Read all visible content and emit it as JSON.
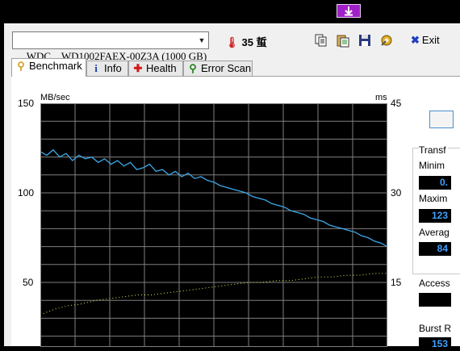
{
  "drive": {
    "name": "WDC    WD1002FAEX-00Z3A (1000 GB)"
  },
  "temperature": {
    "value": "35",
    "unit": "蜇"
  },
  "toolbar": {
    "exit_label": "Exit"
  },
  "tabs": [
    {
      "label": "Benchmark",
      "icon": "benchmark-icon"
    },
    {
      "label": "Info",
      "icon": "info-icon"
    },
    {
      "label": "Health",
      "icon": "health-cross-icon"
    },
    {
      "label": "Error Scan",
      "icon": "magnifier-icon"
    }
  ],
  "chart_data": {
    "type": "line",
    "ylabel": "MB/sec",
    "y2label": "ms",
    "ylim": [
      0,
      150
    ],
    "y2lim": [
      0,
      45
    ],
    "yticks": [
      "150",
      "100",
      "50"
    ],
    "y2ticks": [
      "45",
      "30",
      "15"
    ],
    "grid": true,
    "series": [
      {
        "color": "#3da8e8",
        "values": [
          123,
          121,
          124,
          120,
          122,
          118,
          121,
          119,
          120,
          117,
          119,
          116,
          118,
          115,
          117,
          113,
          114,
          116,
          112,
          113,
          110,
          112,
          109,
          111,
          108,
          109,
          107,
          106,
          104,
          103,
          102,
          101,
          100,
          98,
          97,
          96,
          94,
          93,
          92,
          90,
          89,
          88,
          86,
          85,
          84,
          82,
          81,
          80,
          79,
          78,
          76,
          75,
          73,
          72,
          70
        ]
      },
      {
        "color": "#e8e850",
        "values": [
          32,
          35,
          37,
          38,
          40,
          41,
          42,
          43,
          43,
          44,
          45,
          46,
          47,
          48,
          49,
          50,
          50,
          51,
          51,
          52,
          53,
          53,
          54,
          54,
          55,
          55
        ]
      }
    ]
  },
  "side": {
    "transfer_label": "Transf",
    "minimum_label": "Minim",
    "minimum_value": "0.",
    "maximum_label": "Maxim",
    "maximum_value": "123",
    "average_label": "Averag",
    "average_value": "84",
    "access_label": "Access",
    "access_value": "",
    "burst_label": "Burst R",
    "burst_value": "153"
  }
}
